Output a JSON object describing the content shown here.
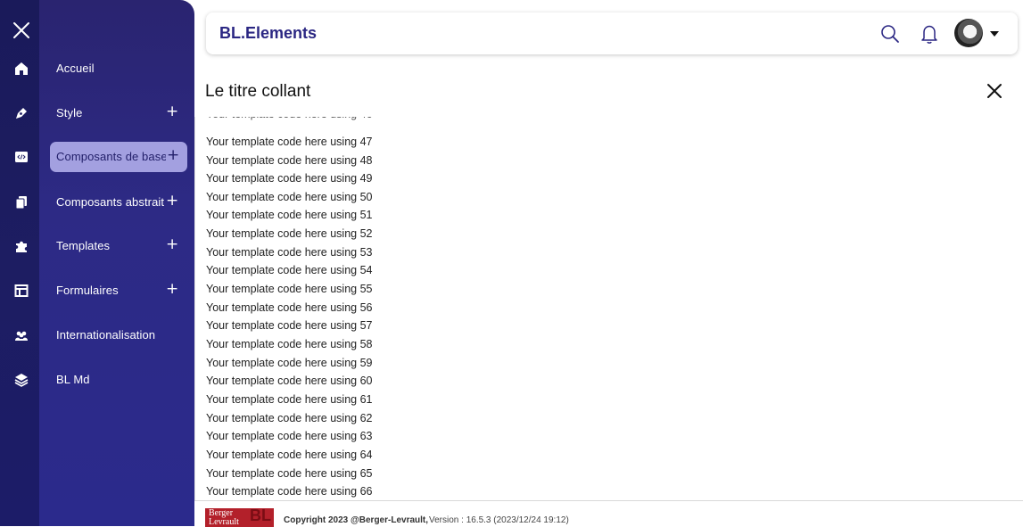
{
  "sidebar": {
    "items": [
      {
        "label": "Accueil",
        "icon": "home-icon",
        "has_plus": false
      },
      {
        "label": "Style",
        "icon": "pen-icon",
        "has_plus": true
      },
      {
        "label": "Composants de base",
        "icon": "code-icon",
        "has_plus": true,
        "active": true
      },
      {
        "label": "Composants abstraits",
        "icon": "copy-icon",
        "has_plus": true
      },
      {
        "label": "Templates",
        "icon": "puzzle-icon",
        "has_plus": true
      },
      {
        "label": "Formulaires",
        "icon": "layout-icon",
        "has_plus": true
      },
      {
        "label": "Internationalisation",
        "icon": "people-icon",
        "has_plus": false
      },
      {
        "label": "BL Md",
        "icon": "layers-icon",
        "has_plus": false
      }
    ],
    "plus_symbol": "+"
  },
  "header": {
    "title": "BL.Elements"
  },
  "page": {
    "title": "Le titre collant",
    "lines": [
      "Your template code here using 47",
      "Your template code here using 48",
      "Your template code here using 49",
      "Your template code here using 50",
      "Your template code here using 51",
      "Your template code here using 52",
      "Your template code here using 53",
      "Your template code here using 54",
      "Your template code here using 55",
      "Your template code here using 56",
      "Your template code here using 57",
      "Your template code here using 58",
      "Your template code here using 59",
      "Your template code here using 60",
      "Your template code here using 61",
      "Your template code here using 62",
      "Your template code here using 63",
      "Your template code here using 64",
      "Your template code here using 65",
      "Your template code here using 66"
    ]
  },
  "footer": {
    "logo_line1": "Berger",
    "logo_line2": "Levrault",
    "logo_mark": "BL",
    "copyright": "Copyright 2023 @Berger-Levrault,",
    "version": "Version : 16.5.3 (2023/12/24 19:12)"
  },
  "colors": {
    "sidebar": "#2d2a85",
    "rail": "#1c1c62",
    "active_pill": "#a3a0e0",
    "brand": "#2b2783",
    "logo": "#b3202a"
  }
}
